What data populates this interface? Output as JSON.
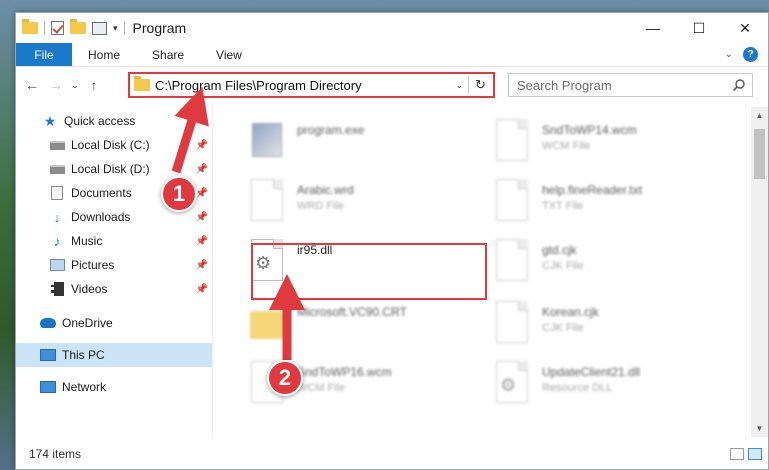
{
  "window": {
    "title": "Program"
  },
  "ribbon": {
    "file": "File",
    "tabs": [
      "Home",
      "Share",
      "View"
    ],
    "help": "?"
  },
  "address": {
    "path": "C:\\Program Files\\Program Directory",
    "search_placeholder": "Search Program"
  },
  "nav": {
    "items": [
      {
        "label": "Quick access",
        "icon": "star-icon"
      },
      {
        "label": "Local Disk (C:)",
        "icon": "drive-icon",
        "pinned": true
      },
      {
        "label": "Local Disk (D:)",
        "icon": "drive-icon",
        "pinned": true
      },
      {
        "label": "Documents",
        "icon": "documents-icon",
        "pinned": true
      },
      {
        "label": "Downloads",
        "icon": "downloads-icon",
        "pinned": true
      },
      {
        "label": "Music",
        "icon": "music-icon",
        "pinned": true
      },
      {
        "label": "Pictures",
        "icon": "pictures-icon",
        "pinned": true
      },
      {
        "label": "Videos",
        "icon": "videos-icon",
        "pinned": true
      },
      {
        "label": "OneDrive",
        "icon": "onedrive-icon"
      },
      {
        "label": "This PC",
        "icon": "this-pc-icon",
        "selected": true
      },
      {
        "label": "Network",
        "icon": "network-icon"
      }
    ]
  },
  "files": {
    "left": [
      {
        "name": "program.exe",
        "type": ""
      },
      {
        "name": "Arabic.wrd",
        "type": "WRD File"
      },
      {
        "name": "ir95.dll",
        "type": ""
      },
      {
        "name": "Microsoft.VC90.CRT",
        "type": ""
      },
      {
        "name": "SndToWP16.wcm",
        "type": "WCM File"
      }
    ],
    "right": [
      {
        "name": "SndToWP14.wcm",
        "type": "WCM File"
      },
      {
        "name": "help.fineReader.txt",
        "type": "TXT File"
      },
      {
        "name": "gtd.cjk",
        "type": "CJK File"
      },
      {
        "name": "Korean.cjk",
        "type": "CJK File"
      },
      {
        "name": "UpdateClient21.dll",
        "type": "Resource DLL"
      }
    ]
  },
  "status": {
    "item_count": "174 items"
  },
  "annotations": {
    "step1": "1",
    "step2": "2"
  },
  "colors": {
    "accent": "#1979ca",
    "highlight": "#e0393e",
    "selected_bg": "#cce4f7"
  }
}
